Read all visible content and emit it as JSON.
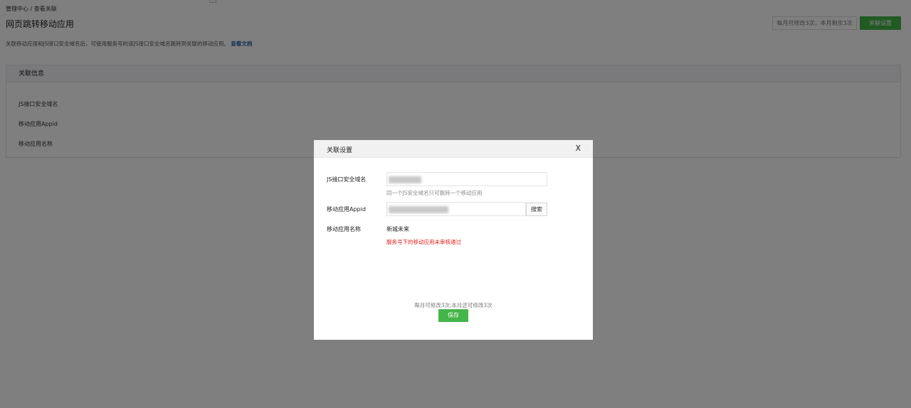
{
  "tooltip": "",
  "breadcrumb": "管理中心 / 查看关联",
  "page_title": "网页跳转移动应用",
  "header": {
    "quota_text": "每月可修改3次，本月剩余3次",
    "settings_button": "关联设置"
  },
  "description": {
    "text": "关联移动应用和JS接口安全域名后，可使用服务号的该JS接口安全域名跳转到关联的移动应用。",
    "link": "查看文档"
  },
  "panel": {
    "title": "关联信息",
    "rows": [
      "JS接口安全域名",
      "移动应用Appid",
      "移动应用名称"
    ]
  },
  "modal": {
    "title": "关联设置",
    "close": "X",
    "domain_label": "JS接口安全域名",
    "domain_hint": "同一个JS安全域名只可跳转一个移动应用",
    "appid_label": "移动应用Appid",
    "search_button": "搜索",
    "name_label": "移动应用名称",
    "name_value": "新城未来",
    "error_text": "服务号下的移动应用未审核通过",
    "footer_note": "每月可修改3次,本月还可修改3次",
    "save_button": "保存"
  }
}
